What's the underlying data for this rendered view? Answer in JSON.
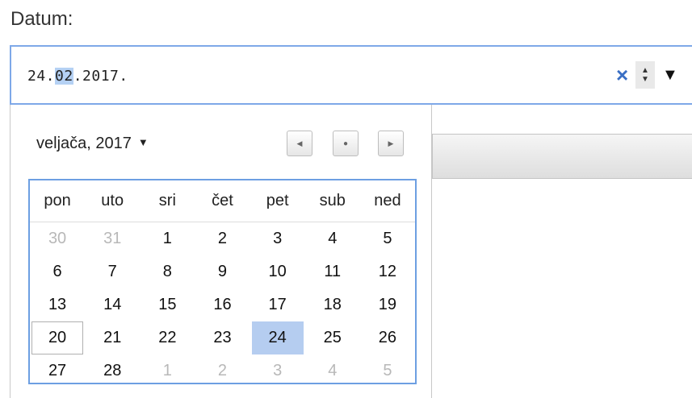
{
  "field": {
    "label": "Datum:",
    "value_pre": "24.",
    "value_selected_segment": "02",
    "value_post": ".2017.",
    "clear_glyph": "×",
    "spin_up_glyph": "▲",
    "spin_down_glyph": "▼",
    "dropdown_glyph": "▼",
    "icons": [
      "clear-icon",
      "spin-icon",
      "dropdown-icon"
    ]
  },
  "calendar": {
    "month_label": "veljača, 2017",
    "month_caret": "▼",
    "nav": {
      "prev": "◀",
      "today": "●",
      "next": "▶"
    },
    "weekdays": [
      "pon",
      "uto",
      "sri",
      "čet",
      "pet",
      "sub",
      "ned"
    ],
    "weeks": [
      [
        {
          "d": "30",
          "o": true
        },
        {
          "d": "31",
          "o": true
        },
        {
          "d": "1"
        },
        {
          "d": "2"
        },
        {
          "d": "3"
        },
        {
          "d": "4"
        },
        {
          "d": "5"
        }
      ],
      [
        {
          "d": "6"
        },
        {
          "d": "7"
        },
        {
          "d": "8"
        },
        {
          "d": "9"
        },
        {
          "d": "10"
        },
        {
          "d": "11"
        },
        {
          "d": "12"
        }
      ],
      [
        {
          "d": "13"
        },
        {
          "d": "14"
        },
        {
          "d": "15"
        },
        {
          "d": "16"
        },
        {
          "d": "17"
        },
        {
          "d": "18"
        },
        {
          "d": "19"
        }
      ],
      [
        {
          "d": "20",
          "today": true
        },
        {
          "d": "21"
        },
        {
          "d": "22"
        },
        {
          "d": "23"
        },
        {
          "d": "24",
          "selected": true
        },
        {
          "d": "25"
        },
        {
          "d": "26"
        }
      ],
      [
        {
          "d": "27"
        },
        {
          "d": "28"
        },
        {
          "d": "1",
          "o": true
        },
        {
          "d": "2",
          "o": true
        },
        {
          "d": "3",
          "o": true
        },
        {
          "d": "4",
          "o": true
        },
        {
          "d": "5",
          "o": true
        }
      ]
    ]
  },
  "colors": {
    "input_border": "#7ea8e8",
    "selection": "#b5d1f4",
    "selected_day": "#b5cdf0",
    "clear_icon": "#3a6fc4"
  }
}
